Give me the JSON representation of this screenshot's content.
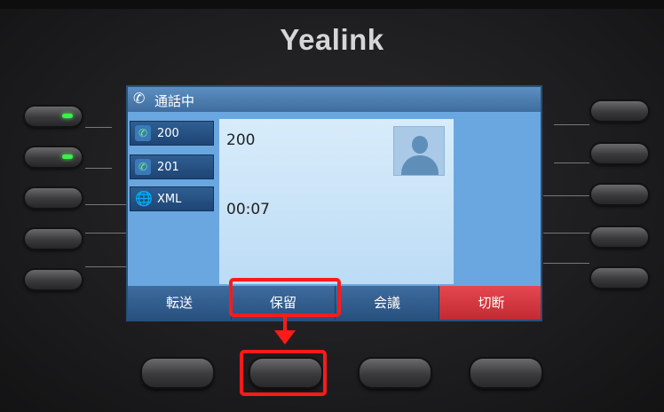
{
  "brand": "Yealink",
  "screen": {
    "title": "通話中",
    "lines": [
      {
        "label": "200",
        "icon": "phone-active-icon"
      },
      {
        "label": "201",
        "icon": "phone-active-icon"
      },
      {
        "label": "XML",
        "icon": "globe-icon"
      }
    ],
    "call": {
      "number": "200",
      "duration": "00:07"
    },
    "softkeys": [
      {
        "label": "転送"
      },
      {
        "label": "保留"
      },
      {
        "label": "会議"
      },
      {
        "label": "切断"
      }
    ]
  },
  "colors": {
    "screen_bg": "#6aa7e0",
    "softkey_blue": "#3e6c9e",
    "softkey_end_red": "#d63a42",
    "highlight_red": "#ff1a1a",
    "led_green": "#3df04a"
  }
}
